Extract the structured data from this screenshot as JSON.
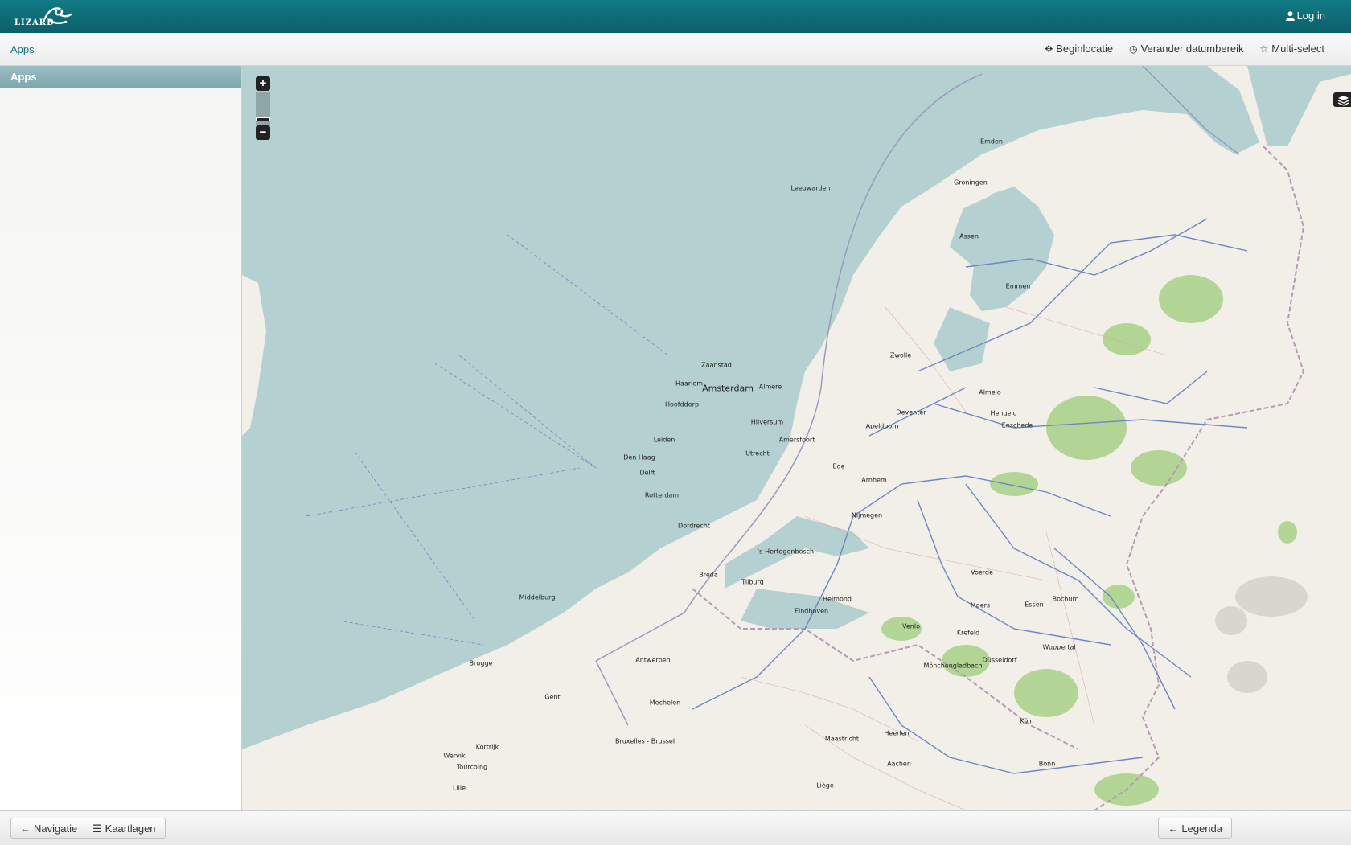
{
  "header": {
    "logo_text": "LIZARD",
    "login_label": "Log in"
  },
  "subnav": {
    "apps_label": "Apps",
    "actions": [
      {
        "label": "Beginlocatie",
        "icon": "move-icon"
      },
      {
        "label": "Verander datumbereik",
        "icon": "clock-icon"
      },
      {
        "label": "Multi-select",
        "icon": "star-icon"
      }
    ]
  },
  "sidebar": {
    "title": "Apps"
  },
  "map": {
    "zoom_in": "+",
    "zoom_out": "−",
    "cities": [
      {
        "name": "Emden"
      },
      {
        "name": "Leeuwarden"
      },
      {
        "name": "Groningen"
      },
      {
        "name": "Assen"
      },
      {
        "name": "Emmen"
      },
      {
        "name": "Zaanstad"
      },
      {
        "name": "Haarlem"
      },
      {
        "name": "Amsterdam"
      },
      {
        "name": "Almere"
      },
      {
        "name": "Hoofddorp"
      },
      {
        "name": "Zwolle"
      },
      {
        "name": "Almelo"
      },
      {
        "name": "Deventer"
      },
      {
        "name": "Hengelo"
      },
      {
        "name": "Enschede"
      },
      {
        "name": "Hilversum"
      },
      {
        "name": "Apeldoorn"
      },
      {
        "name": "Leiden"
      },
      {
        "name": "Amersfoort"
      },
      {
        "name": "Utrecht"
      },
      {
        "name": "Den Haag"
      },
      {
        "name": "Ede"
      },
      {
        "name": "Delft"
      },
      {
        "name": "Arnhem"
      },
      {
        "name": "Rotterdam"
      },
      {
        "name": "Nijmegen"
      },
      {
        "name": "Dordrecht"
      },
      {
        "name": "'s-Hertogenbosch"
      },
      {
        "name": "Voerde"
      },
      {
        "name": "Breda"
      },
      {
        "name": "Tilburg"
      },
      {
        "name": "Helmond"
      },
      {
        "name": "Bochum"
      },
      {
        "name": "Middelburg"
      },
      {
        "name": "Moers"
      },
      {
        "name": "Essen"
      },
      {
        "name": "Eindhoven"
      },
      {
        "name": "Venlo"
      },
      {
        "name": "Krefeld"
      },
      {
        "name": "Wuppertal"
      },
      {
        "name": "Brugge"
      },
      {
        "name": "Antwerpen"
      },
      {
        "name": "Mönchengladbach"
      },
      {
        "name": "Düsseldorf"
      },
      {
        "name": "Gent"
      },
      {
        "name": "Mechelen"
      },
      {
        "name": "Köln"
      },
      {
        "name": "Heerlen"
      },
      {
        "name": "Bruxelles - Brussel"
      },
      {
        "name": "Maastricht"
      },
      {
        "name": "Kortrijk"
      },
      {
        "name": "Wervik"
      },
      {
        "name": "Aachen"
      },
      {
        "name": "Tourcoing"
      },
      {
        "name": "Bonn"
      },
      {
        "name": "Lille"
      },
      {
        "name": "Liège"
      }
    ]
  },
  "footer": {
    "nav_label": "Navigatie",
    "layers_label": "Kaartlagen",
    "legend_label": "Legenda"
  },
  "colors": {
    "brand": "#0f6f7a",
    "sea": "#b5d0d0",
    "land": "#f2efe9",
    "forest": "#8cc26a",
    "road": "#6d86c4"
  }
}
